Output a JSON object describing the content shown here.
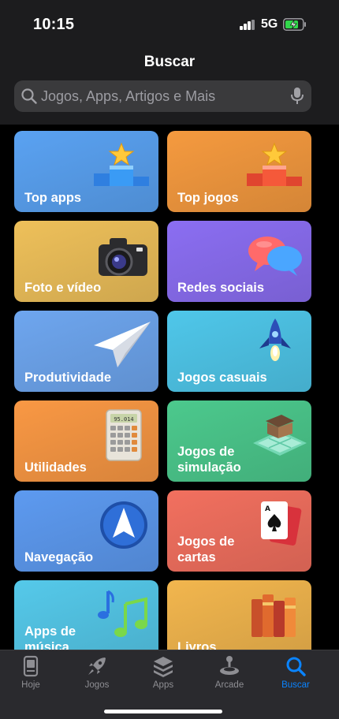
{
  "status_bar": {
    "time": "10:15",
    "network": "5G"
  },
  "header": {
    "title": "Buscar"
  },
  "search": {
    "placeholder": "Jogos, Apps, Artigos e Mais"
  },
  "categories": [
    {
      "label": "Top apps",
      "color": "#5aa2f2",
      "icon": "podium-icon"
    },
    {
      "label": "Top jogos",
      "color": "#f59a3f",
      "icon": "podium-icon"
    },
    {
      "label": "Foto e vídeo",
      "color": "#eec05a",
      "icon": "camera-icon"
    },
    {
      "label": "Redes sociais",
      "color": "#8b6ef2",
      "icon": "speech-bubbles-icon"
    },
    {
      "label": "Produtividade",
      "color": "#6ea6ef",
      "icon": "paper-plane-icon"
    },
    {
      "label": "Jogos casuais",
      "color": "#4fc7ea",
      "icon": "rocket-icon"
    },
    {
      "label": "Utilidades",
      "color": "#f99844",
      "icon": "calculator-icon"
    },
    {
      "label": "Jogos de\nsimulação",
      "color": "#4cc98d",
      "icon": "house-tiles-icon"
    },
    {
      "label": "Navegação",
      "color": "#5d9af0",
      "icon": "compass-arrow-icon"
    },
    {
      "label": "Jogos de\ncartas",
      "color": "#f2705f",
      "icon": "playing-cards-icon"
    },
    {
      "label": "Apps de\nmúsica",
      "color": "#55c9ea",
      "icon": "music-note-icon"
    },
    {
      "label": "Livros",
      "color": "#f2b64e",
      "icon": "books-icon"
    }
  ],
  "calculator_display": "95.014",
  "tabs": [
    {
      "label": "Hoje",
      "icon": "today-icon",
      "active": false
    },
    {
      "label": "Jogos",
      "icon": "rocket-icon",
      "active": false
    },
    {
      "label": "Apps",
      "icon": "stack-icon",
      "active": false
    },
    {
      "label": "Arcade",
      "icon": "joystick-icon",
      "active": false
    },
    {
      "label": "Buscar",
      "icon": "search-icon",
      "active": true
    }
  ],
  "colors": {
    "accent": "#0a84ff",
    "inactive": "#8e8e93"
  }
}
